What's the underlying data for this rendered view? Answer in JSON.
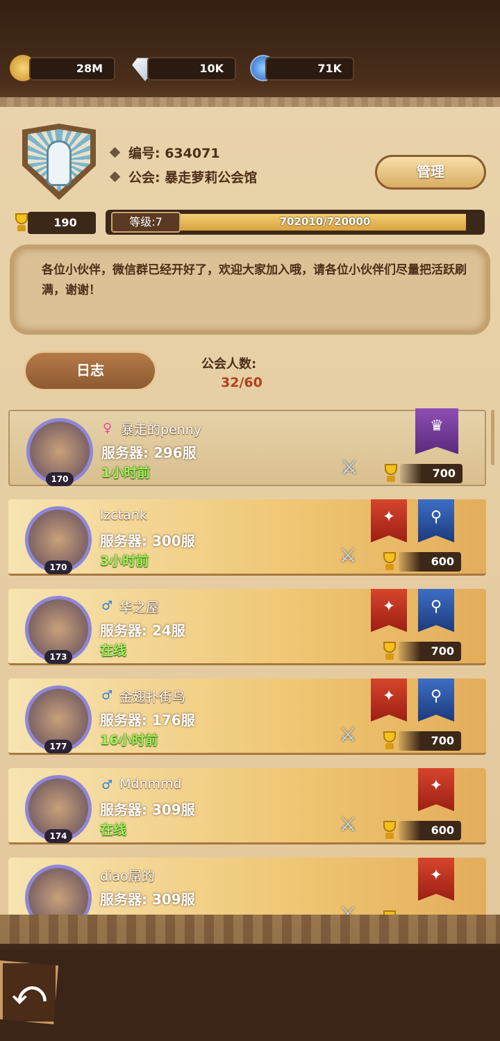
{
  "currencies": [
    {
      "icon": "gold-coin-icon",
      "value": "28M"
    },
    {
      "icon": "diamond-icon",
      "value": "10K"
    },
    {
      "icon": "blue-gem-icon",
      "value": "71K"
    }
  ],
  "guild": {
    "id_label": "编号: 634071",
    "name_label": "公会: 暴走萝莉公会馆",
    "manage_button": "管理",
    "trophy_total": "190",
    "level_label": "等级:7",
    "exp_text": "702010/720000",
    "exp_fraction": 0.975,
    "notice": "各位小伙伴，微信群已经开好了，欢迎大家加入哦，请各位小伙伴们尽量把活跃刷满，谢谢！",
    "log_button": "日志",
    "member_count_label": "公会人数:",
    "member_count_value": "32/60"
  },
  "members": [
    {
      "gender": "♀",
      "gender_color": "#e34b9b",
      "name": "暴走的penny",
      "server": "服务器: 296服",
      "status": "1小时前",
      "level": "170",
      "points": "700",
      "banners": [
        "purple"
      ],
      "swords": true
    },
    {
      "gender": "",
      "gender_color": "",
      "name": "lzctank",
      "server": "服务器: 300服",
      "status": "3小时前",
      "level": "170",
      "points": "600",
      "banners": [
        "red",
        "blue"
      ],
      "swords": true
    },
    {
      "gender": "♂",
      "gender_color": "#2f7fe0",
      "name": "华之屋",
      "server": "服务器: 24服",
      "status": "在线",
      "level": "173",
      "points": "700",
      "banners": [
        "red",
        "blue"
      ],
      "swords": false
    },
    {
      "gender": "♂",
      "gender_color": "#2f7fe0",
      "name": "金翅扑街鸟",
      "server": "服务器: 176服",
      "status": "16小时前",
      "level": "177",
      "points": "700",
      "banners": [
        "red",
        "blue"
      ],
      "swords": true
    },
    {
      "gender": "♂",
      "gender_color": "#2f7fe0",
      "name": "Mdnmmd",
      "server": "服务器: 309服",
      "status": "在线",
      "level": "174",
      "points": "600",
      "banners": [
        "red"
      ],
      "swords": true
    },
    {
      "gender": "",
      "gender_color": "",
      "name": "diao屌的",
      "server": "服务器: 309服",
      "status": "",
      "level": "",
      "points": "",
      "banners": [
        "red"
      ],
      "swords": true
    }
  ],
  "back_button": "⤺"
}
